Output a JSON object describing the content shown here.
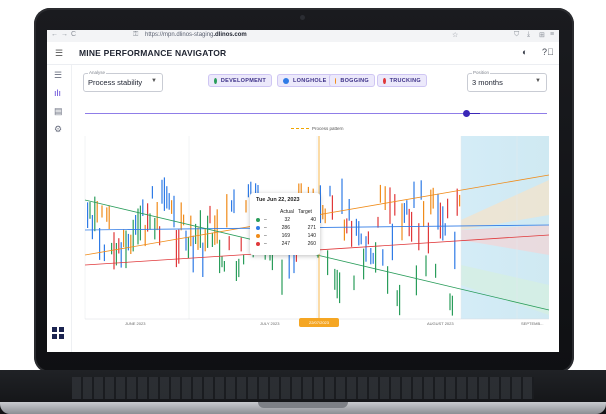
{
  "browser": {
    "url_prefix": "https://mpn.",
    "url_domain": "dlinos-staging",
    "url_suffix": ".dlinos.com",
    "back": "←",
    "forward": "→",
    "reload": "C"
  },
  "header": {
    "title": "MINE PERFORMANCE NAVIGATOR"
  },
  "controls": {
    "analyse_label": "Analyse",
    "analyse_value": "Process stability",
    "position_label": "Position",
    "position_value": "3 months",
    "chips": [
      {
        "label": "DEVELOPMENT",
        "color": "#2a9d5b"
      },
      {
        "label": "LONGHOLE",
        "color": "#2f7be6"
      },
      {
        "label": "BOGGING",
        "color": "#f08c1a"
      },
      {
        "label": "TRUCKING",
        "color": "#e0383a"
      }
    ]
  },
  "legend": {
    "text": "Process pattern"
  },
  "tooltip": {
    "title": "Tue Jun 22, 2023",
    "col_actual": "Actual",
    "col_target": "Target",
    "rows": [
      {
        "dash": "–",
        "actual": "32",
        "target": "40",
        "color": "#2a9d5b"
      },
      {
        "dash": "–",
        "actual": "286",
        "target": "271",
        "color": "#2f7be6"
      },
      {
        "dash": "–",
        "actual": "169",
        "target": "140",
        "color": "#f08c1a"
      },
      {
        "dash": "–",
        "actual": "247",
        "target": "260",
        "color": "#e0383a"
      }
    ]
  },
  "axis": {
    "labels": [
      "JUNE 2023",
      "JULY 2023",
      "AUGUST 2023",
      "SEPTEMB..."
    ],
    "current": "22/07/2023"
  },
  "colors": {
    "accent": "#5b3fd6",
    "green": "#2a9d5b",
    "blue": "#2f7be6",
    "orange": "#f08c1a",
    "red": "#e0383a"
  },
  "icons": {
    "sidebar": [
      "layers-icon",
      "bar-chart-icon",
      "clipboard-icon",
      "settings-icon"
    ],
    "header": [
      "theme-toggle-icon",
      "help-icon"
    ]
  }
}
